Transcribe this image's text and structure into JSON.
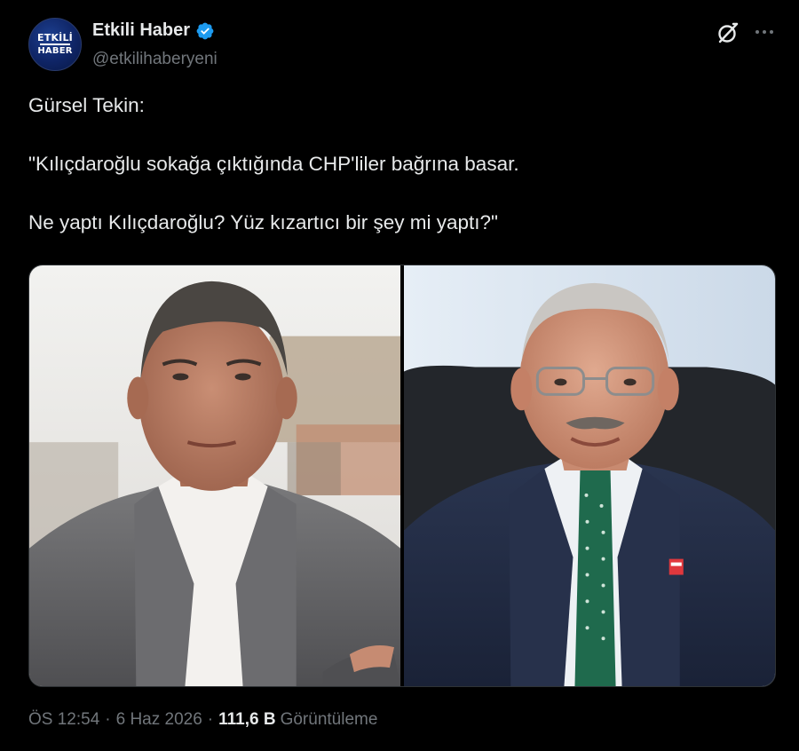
{
  "author": {
    "display_name": "Etkili Haber",
    "handle": "@etkilihaberyeni",
    "verified": true,
    "avatar": {
      "line1": "ETKİLİ",
      "line2": "HABER"
    }
  },
  "header_icons": [
    "grok-icon",
    "more-icon"
  ],
  "tweet": {
    "paragraphs": [
      "Gürsel Tekin:",
      "\"Kılıçdaroğlu sokağa çıktığında CHP'liler bağrına basar.",
      "Ne yaptı Kılıçdaroğlu? Yüz kızartıcı bir şey mi yaptı?\""
    ]
  },
  "media": {
    "photo_count": 2
  },
  "meta": {
    "time": "ÖS 12:54",
    "separator": "·",
    "date": "6 Haz 2026",
    "views_count": "111,6 B",
    "views_label": "Görüntüleme"
  },
  "colors": {
    "background": "#000000",
    "text_primary": "#e7e9ea",
    "text_secondary": "#71767b",
    "verified_badge": "#1d9bf0",
    "border": "#2f3336"
  }
}
